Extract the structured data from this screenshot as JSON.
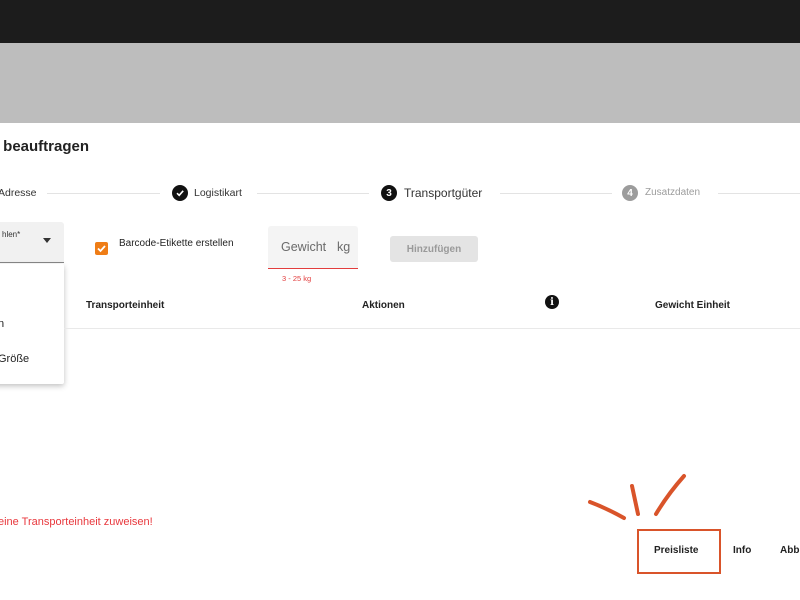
{
  "title": "t beauftragen",
  "steps": [
    {
      "label": "Adresse",
      "state": "done"
    },
    {
      "label": "Logistikart",
      "state": "done"
    },
    {
      "label": "Transportgüter",
      "number": "3",
      "state": "active"
    },
    {
      "label": "Zusatzdaten",
      "number": "4",
      "state": "inactive"
    }
  ],
  "form": {
    "select_label": "hlen*",
    "dropdown_options": [
      "n",
      "Größe"
    ],
    "checkbox_label": "Barcode-Etikette erstellen",
    "checkbox_checked": true,
    "weight_placeholder": "Gewicht",
    "weight_unit": "kg",
    "weight_hint": "3 - 25 kg",
    "add_button": "Hinzufügen"
  },
  "table": {
    "headers": [
      "Transporteinheit",
      "Aktionen",
      "Gewicht Einheit"
    ],
    "info_icon_glyph": "i"
  },
  "error_message": "eine Transporteinheit zuweisen!",
  "footer": {
    "preisliste": "Preisliste",
    "info": "Info",
    "abbrechen": "Abb"
  },
  "colors": {
    "accent": "#ef7d16",
    "error": "#e8383d",
    "annotation": "#d9542a",
    "header_dark": "#1c1c1c",
    "header_gray": "#bdbdbd"
  }
}
